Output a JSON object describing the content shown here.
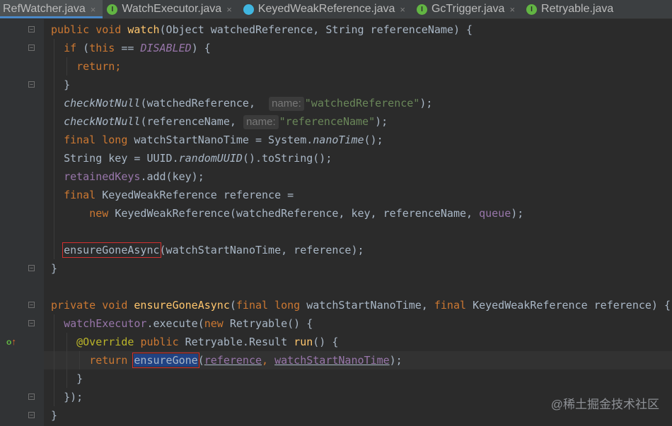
{
  "tabs": [
    {
      "name": "RefWatcher.java",
      "icon": "class-icon",
      "active": true
    },
    {
      "name": "WatchExecutor.java",
      "icon": "interface-icon",
      "active": false
    },
    {
      "name": "KeyedWeakReference.java",
      "icon": "class-icon",
      "active": false
    },
    {
      "name": "GcTrigger.java",
      "icon": "interface-icon",
      "active": false
    },
    {
      "name": "Retryable.java",
      "icon": "interface-icon",
      "active": false
    }
  ],
  "tab_close_glyph": "×",
  "icon_letter": "I",
  "impl_marker": {
    "glyph": "o",
    "arrow": "↑"
  },
  "code": {
    "watch_kw": "public void ",
    "watch_name": "watch",
    "watch_params": "(Object watchedReference, String referenceName) {",
    "if_kw": "if",
    "this_kw": "this",
    "eq": " == ",
    "disabled": "DISABLED",
    "if_close": ") {",
    "return_kw": "return",
    "semi": ";",
    "close_brace": "}",
    "check_fn": "checkNotNull",
    "check1_arg": "(watchedReference,",
    "hint_name": "name:",
    "check1_str": "\"watchedReference\"",
    "check2_arg": "(referenceName,",
    "check2_str": "\"referenceName\"",
    "call_end": ");",
    "final_long": "final long ",
    "start_var": "watchStartNanoTime = System.",
    "nano_time": "nanoTime",
    "paren_end": "();",
    "string_key": "String key = UUID.",
    "random_uuid": "randomUUID",
    "to_string": "().toString();",
    "retained_keys": "retainedKeys",
    "add_key": ".add(key);",
    "final_kw": "final ",
    "keyed_ref_decl": "KeyedWeakReference reference =",
    "new_kw": "new ",
    "keyed_ctor": "KeyedWeakReference(watchedReference, key, referenceName, ",
    "queue": "queue",
    "ensure_async_call": "ensureGoneAsync",
    "ensure_async_args": "(watchStartNanoTime, reference);",
    "private_void": "private void ",
    "ensure_async_name": "ensureGoneAsync",
    "ensure_async_sig1": "(",
    "ensure_async_sig2": "watchStartNanoTime, ",
    "ensure_async_sig3": "KeyedWeakReference reference) {",
    "watch_executor": "watchExecutor",
    "execute_call": ".execute(",
    "retryable_open": "Retryable() {",
    "override_ann": "@Override ",
    "public_kw": "public ",
    "result_type": "Retryable.Result ",
    "run_name": "run",
    "run_open": "() {",
    "ensure_gone": "ensureGone",
    "open_paren": "(",
    "arg_reference": "reference",
    "comma": ", ",
    "arg_start": "watchStartNanoTime",
    "close_inner": "});"
  },
  "watermark": "@稀土掘金技术社区"
}
